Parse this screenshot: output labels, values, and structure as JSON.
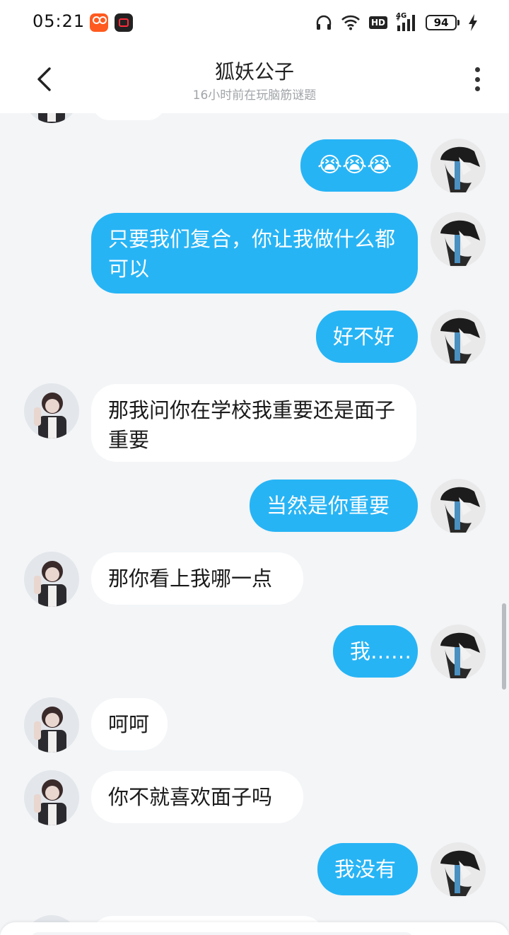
{
  "status_bar": {
    "time": "05:21",
    "apps": [
      "kuaishou-app-icon",
      "video-recorder-app-icon"
    ],
    "icons": [
      "headphones-icon",
      "wifi-icon",
      "hd-icon",
      "signal-4g-icon",
      "battery-icon",
      "charging-icon"
    ],
    "hd_label": "HD",
    "network_label": "4G",
    "battery_level": "94"
  },
  "header": {
    "title": "狐妖公子",
    "subtitle": "16小时前在玩脑筋谜题"
  },
  "messages": [
    {
      "sender": "self",
      "text": "😭😭😭"
    },
    {
      "sender": "self",
      "text": "只要我们复合，你让我做什么都可以"
    },
    {
      "sender": "self",
      "text": "好不好"
    },
    {
      "sender": "peer",
      "text": "那我问你在学校我重要还是面子重要"
    },
    {
      "sender": "self",
      "text": "当然是你重要"
    },
    {
      "sender": "peer",
      "text": "那你看上我哪一点"
    },
    {
      "sender": "self",
      "text": "我……"
    },
    {
      "sender": "peer",
      "text": "呵呵"
    },
    {
      "sender": "peer",
      "text": "你不就喜欢面子吗"
    },
    {
      "sender": "self",
      "text": "我没有"
    }
  ],
  "colors": {
    "outgoing_bubble": "#27b4f5",
    "incoming_bubble": "#ffffff",
    "chat_background": "#f3f5f7"
  }
}
